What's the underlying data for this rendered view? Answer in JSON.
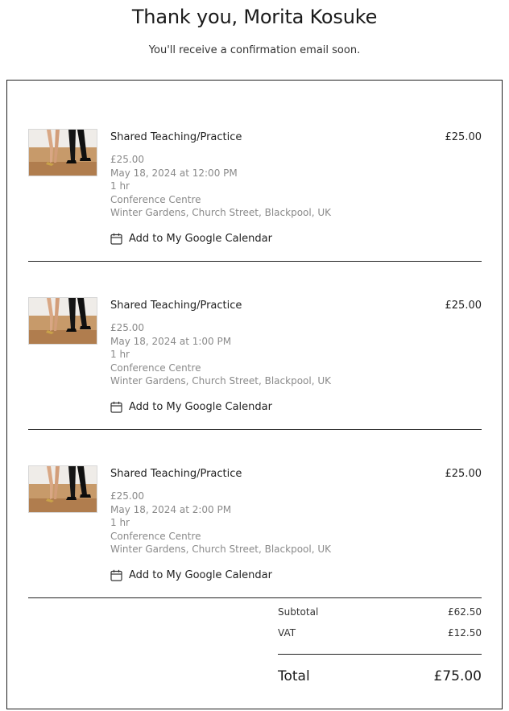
{
  "header": {
    "title": "Thank you, Morita Kosuke",
    "subtitle": "You'll receive a confirmation email soon."
  },
  "items": [
    {
      "name": "Shared Teaching/Practice",
      "price": "£25.00",
      "unit_price": "£25.00",
      "datetime": "May 18, 2024 at 12:00 PM",
      "duration": "1 hr",
      "venue": "Conference Centre",
      "address": "Winter Gardens, Church Street, Blackpool, UK",
      "calendar_label": "Add to My Google Calendar",
      "calendar_icon": "calendar-icon"
    },
    {
      "name": "Shared Teaching/Practice",
      "price": "£25.00",
      "unit_price": "£25.00",
      "datetime": "May 18, 2024 at 1:00 PM",
      "duration": "1 hr",
      "venue": "Conference Centre",
      "address": "Winter Gardens, Church Street, Blackpool, UK",
      "calendar_label": "Add to My Google Calendar",
      "calendar_icon": "calendar-icon"
    },
    {
      "name": "Shared Teaching/Practice",
      "price": "£25.00",
      "unit_price": "£25.00",
      "datetime": "May 18, 2024 at 2:00 PM",
      "duration": "1 hr",
      "venue": "Conference Centre",
      "address": "Winter Gardens, Church Street, Blackpool, UK",
      "calendar_label": "Add to My Google Calendar",
      "calendar_icon": "calendar-icon"
    }
  ],
  "summary": {
    "subtotal_label": "Subtotal",
    "subtotal_value": "£62.50",
    "vat_label": "VAT",
    "vat_value": "£12.50",
    "total_label": "Total",
    "total_value": "£75.00"
  }
}
